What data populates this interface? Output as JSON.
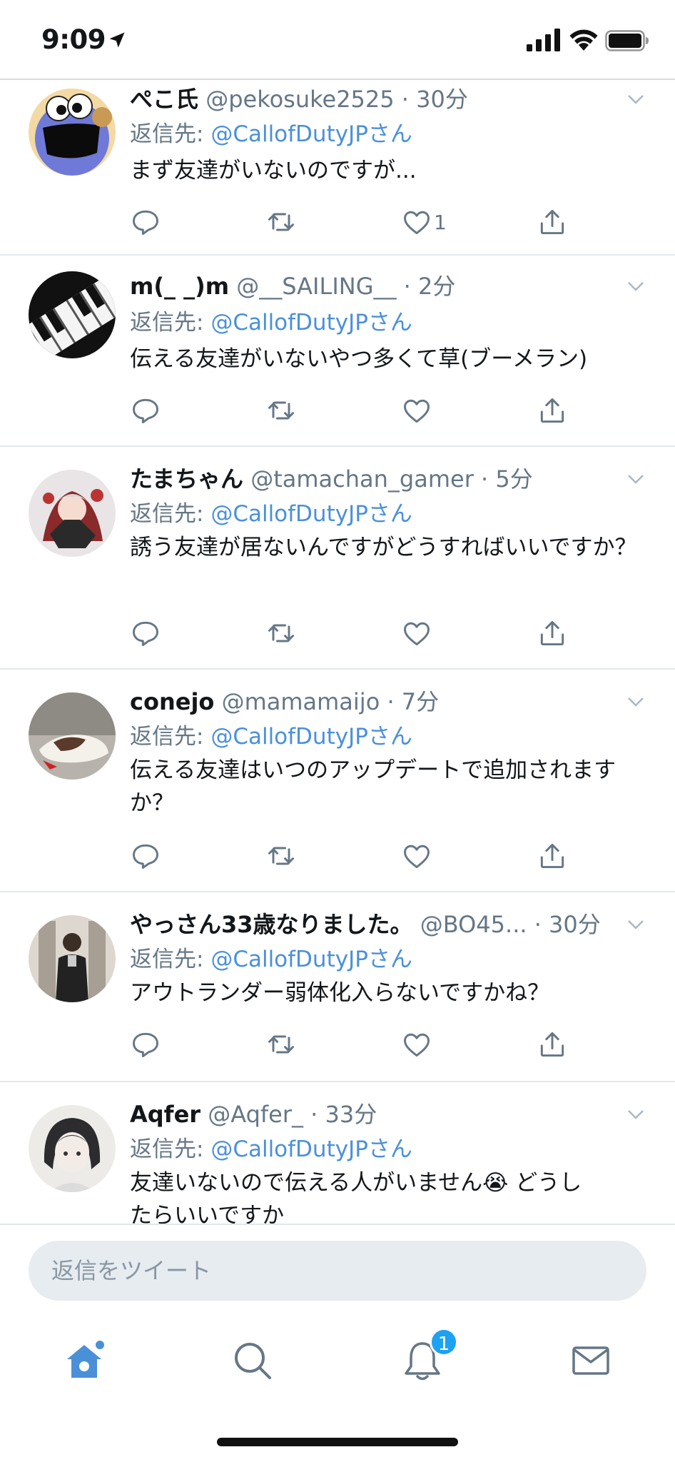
{
  "status_bar": {
    "time": "9:09"
  },
  "reply_prefix": "返信先: ",
  "tweets": [
    {
      "name": "ぺこ氏",
      "handle": "@pekosuke2525",
      "time": "30分",
      "reply_to": "@CallofDutyJPさん",
      "text": "まず友達がいないのですが...",
      "like_count": "1"
    },
    {
      "name": "m(_ _)m",
      "handle": "@__SAILING__",
      "time": "2分",
      "reply_to": "@CallofDutyJPさん",
      "text": "伝える友達がいないやつ多くて草(ブーメラン)",
      "like_count": ""
    },
    {
      "name": "たまちゃん",
      "handle": "@tamachan_gamer",
      "time": "5分",
      "reply_to": "@CallofDutyJPさん",
      "text": "誘う友達が居ないんですがどうすればいいですか？",
      "like_count": ""
    },
    {
      "name": "conejo",
      "handle": "@mamamaijo",
      "time": "7分",
      "reply_to": "@CallofDutyJPさん",
      "text": "伝える友達はいつのアップデートで追加されますか？",
      "like_count": ""
    },
    {
      "name": "やっさん33歳なりました。",
      "handle": "@BO45...",
      "time": "30分",
      "reply_to": "@CallofDutyJPさん",
      "text": "アウトランダー弱体化入らないですかね？",
      "like_count": ""
    },
    {
      "name": "Aqfer",
      "handle": "@Aqfer_",
      "time": "33分",
      "reply_to": "@CallofDutyJPさん",
      "text": "友達いないので伝える人がいません😭 どうしたらいいですか",
      "like_count": ""
    }
  ],
  "composer": {
    "placeholder": "返信をツイート"
  },
  "tabbar": {
    "notifications_badge": "1"
  },
  "colors": {
    "accent": "#1da1f2",
    "link": "#4a90d9",
    "secondary_text": "#657786"
  }
}
